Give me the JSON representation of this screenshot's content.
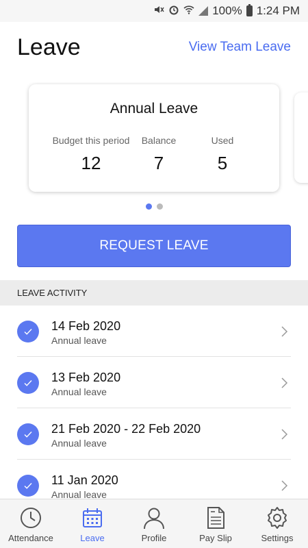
{
  "status_bar": {
    "battery": "100%",
    "time": "1:24 PM",
    "icons": [
      "mute-icon",
      "alarm-icon",
      "wifi-icon",
      "signal-icon",
      "battery-icon"
    ]
  },
  "header": {
    "title": "Leave",
    "team_link": "View Team Leave"
  },
  "leave_card": {
    "title": "Annual Leave",
    "stats": [
      {
        "label": "Budget this period",
        "value": "12"
      },
      {
        "label": "Balance",
        "value": "7"
      },
      {
        "label": "Used",
        "value": "5"
      }
    ],
    "page_count": 2,
    "active_page": 1
  },
  "request_button": {
    "label": "REQUEST LEAVE"
  },
  "activity": {
    "section_title": "LEAVE ACTIVITY",
    "items": [
      {
        "date": "14 Feb 2020",
        "type": "Annual leave"
      },
      {
        "date": "13 Feb 2020",
        "type": "Annual leave"
      },
      {
        "date": "21 Feb 2020 - 22 Feb 2020",
        "type": "Annual leave"
      },
      {
        "date": "11 Jan 2020",
        "type": "Annual leave"
      }
    ]
  },
  "bottom_nav": {
    "items": [
      {
        "label": "Attendance",
        "icon": "clock-icon"
      },
      {
        "label": "Leave",
        "icon": "calendar-icon",
        "active": true
      },
      {
        "label": "Profile",
        "icon": "person-icon"
      },
      {
        "label": "Pay Slip",
        "icon": "document-icon"
      },
      {
        "label": "Settings",
        "icon": "gear-icon"
      }
    ]
  },
  "colors": {
    "accent": "#5b78f0",
    "link": "#4a6cf0",
    "section_bg": "#ececec"
  }
}
